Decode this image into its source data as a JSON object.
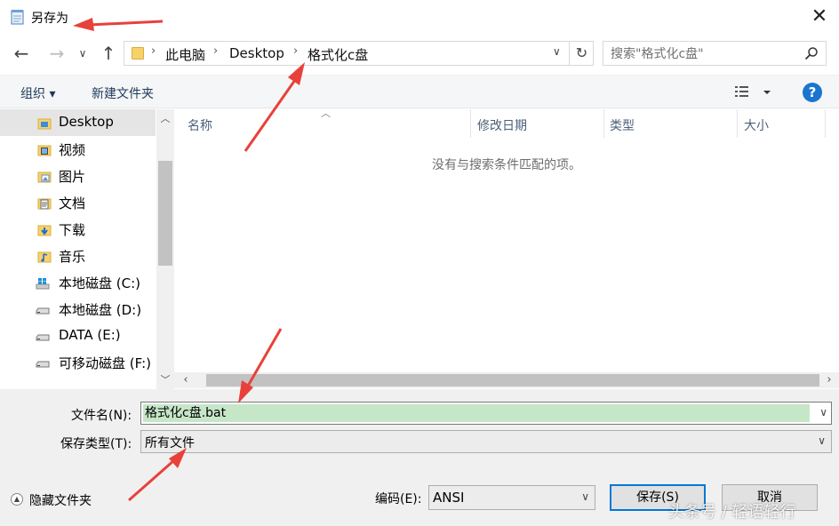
{
  "window": {
    "title": "另存为",
    "close_glyph": "✕"
  },
  "nav": {
    "back_glyph": "←",
    "forward_glyph": "→",
    "history_glyph": "∨",
    "up_glyph": "↑",
    "breadcrumbs": [
      "此电脑",
      "Desktop",
      "格式化c盘"
    ],
    "crumb_sep": "›",
    "refresh_glyph": "↻",
    "search_placeholder": "搜索\"格式化c盘\""
  },
  "toolbar": {
    "organize": "组织 ▾",
    "new_folder": "新建文件夹",
    "help": "?"
  },
  "sidebar": {
    "items": [
      {
        "label": "Desktop",
        "icon": "desktop-folder-icon",
        "selected": true
      },
      {
        "label": "视频",
        "icon": "videos-folder-icon"
      },
      {
        "label": "图片",
        "icon": "pictures-folder-icon"
      },
      {
        "label": "文档",
        "icon": "documents-folder-icon"
      },
      {
        "label": "下载",
        "icon": "downloads-folder-icon"
      },
      {
        "label": "音乐",
        "icon": "music-folder-icon"
      },
      {
        "label": "本地磁盘 (C:)",
        "icon": "system-drive-icon"
      },
      {
        "label": "本地磁盘 (D:)",
        "icon": "drive-icon"
      },
      {
        "label": "DATA (E:)",
        "icon": "drive-icon"
      },
      {
        "label": "可移动磁盘 (F:)",
        "icon": "removable-drive-icon"
      }
    ]
  },
  "filelist": {
    "columns": [
      "名称",
      "修改日期",
      "类型",
      "大小"
    ],
    "empty_message": "没有与搜索条件匹配的项。"
  },
  "form": {
    "filename_label": "文件名(N):",
    "filename_value": "格式化c盘.bat",
    "filetype_label": "保存类型(T):",
    "filetype_value": "所有文件",
    "encoding_label": "编码(E):",
    "encoding_value": "ANSI",
    "hide_folders": "隐藏文件夹",
    "save": "保存(S)",
    "cancel": "取消"
  },
  "watermark": "头条号 / 轻语轻行",
  "colors": {
    "accent": "#0078d7",
    "selection": "#e5e5e5",
    "filename_highlight": "#c6e6c8",
    "annotation_arrow": "#e8413a"
  }
}
